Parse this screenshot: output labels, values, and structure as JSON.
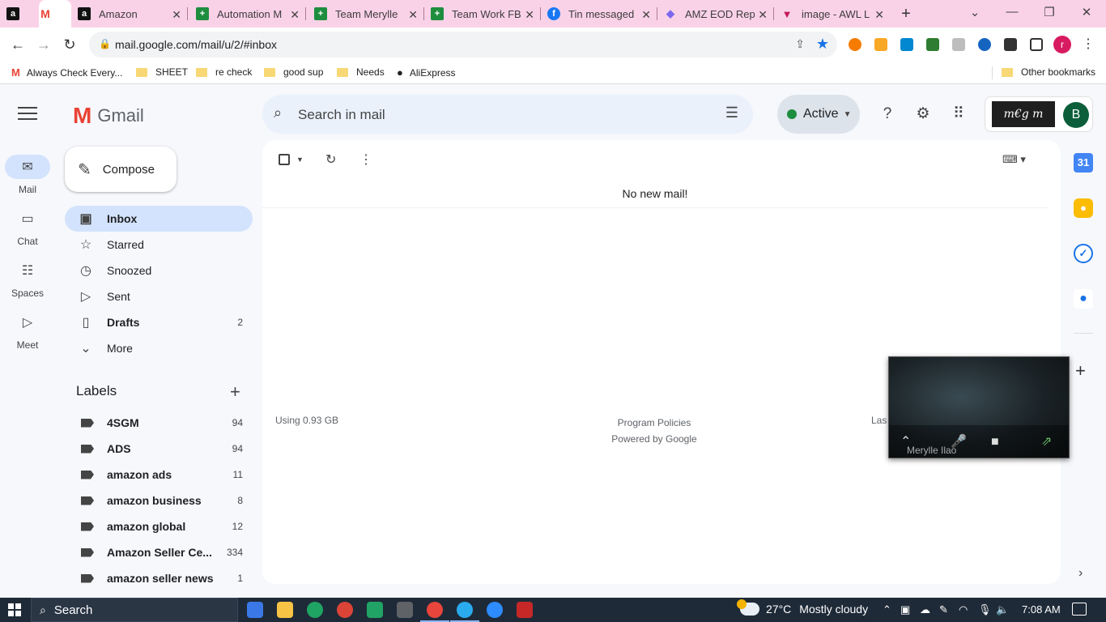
{
  "browser": {
    "tabs": [
      {
        "title": "",
        "favicon": "amazon-icon",
        "active": false
      },
      {
        "title": "",
        "favicon": "gmail-icon",
        "active": true
      },
      {
        "title": "Amazon",
        "favicon": "amazon-icon",
        "active": false
      },
      {
        "title": "Automation M",
        "favicon": "sheets-icon",
        "active": false
      },
      {
        "title": "Team Merylle",
        "favicon": "sheets-icon",
        "active": false
      },
      {
        "title": "Team Work FBA",
        "favicon": "sheets-icon",
        "active": false
      },
      {
        "title": "Tin messaged",
        "favicon": "facebook-icon",
        "active": false
      },
      {
        "title": "AMZ EOD Repo",
        "favicon": "clickup-icon",
        "active": false
      },
      {
        "title": "image - AWL L",
        "favicon": "awl-icon",
        "active": false
      }
    ],
    "url": "mail.google.com/mail/u/2/#inbox",
    "profile_initial": "r",
    "bookmarks": [
      {
        "label": "Always Check Every...",
        "icon": "gmail-icon"
      },
      {
        "label": "SHEET",
        "icon": "folder-icon"
      },
      {
        "label": "re check",
        "icon": "folder-icon"
      },
      {
        "label": "good sup",
        "icon": "folder-icon"
      },
      {
        "label": "Needs",
        "icon": "folder-icon"
      },
      {
        "label": "AliExpress",
        "icon": "globe-icon"
      }
    ],
    "other_bookmarks": "Other bookmarks"
  },
  "gmail": {
    "brand": "Gmail",
    "search_placeholder": "Search in mail",
    "status": "Active",
    "account_initial": "B",
    "signature_text": "m€g m",
    "rail": [
      {
        "label": "Mail",
        "icon": "mail-icon"
      },
      {
        "label": "Chat",
        "icon": "chat-icon"
      },
      {
        "label": "Spaces",
        "icon": "spaces-icon"
      },
      {
        "label": "Meet",
        "icon": "meet-icon"
      }
    ],
    "compose": "Compose",
    "folders": [
      {
        "label": "Inbox",
        "count": "",
        "icon": "inbox-icon"
      },
      {
        "label": "Starred",
        "count": "",
        "icon": "star-icon"
      },
      {
        "label": "Snoozed",
        "count": "",
        "icon": "clock-icon"
      },
      {
        "label": "Sent",
        "count": "",
        "icon": "send-icon"
      },
      {
        "label": "Drafts",
        "count": "2",
        "icon": "draft-icon"
      },
      {
        "label": "More",
        "count": "",
        "icon": "chevron-down-icon"
      }
    ],
    "labels_title": "Labels",
    "labels": [
      {
        "label": "4SGM",
        "count": "94"
      },
      {
        "label": "ADS",
        "count": "94"
      },
      {
        "label": "amazon ads",
        "count": "11"
      },
      {
        "label": "amazon business",
        "count": "8"
      },
      {
        "label": "amazon global",
        "count": "12"
      },
      {
        "label": "Amazon Seller Ce...",
        "count": "334"
      },
      {
        "label": "amazon seller news",
        "count": "1"
      }
    ],
    "empty_message": "No new mail!",
    "storage": "Using 0.93 GB",
    "program_policies": "Program Policies",
    "powered_by": "Powered by Google",
    "last_activity_partial": "Las"
  },
  "video_call": {
    "participant": "Merylle Ilao"
  },
  "taskbar": {
    "search": "Search",
    "weather_temp": "27°C",
    "weather_desc": "Mostly cloudy",
    "time": "7:08 AM"
  },
  "colors": {
    "tab_strip": "#fad2e8",
    "gmail_bg": "#f6f8fc",
    "selected": "#d3e3fd",
    "active_dot": "#1e8e3e",
    "taskbar": "#1f2a38"
  }
}
